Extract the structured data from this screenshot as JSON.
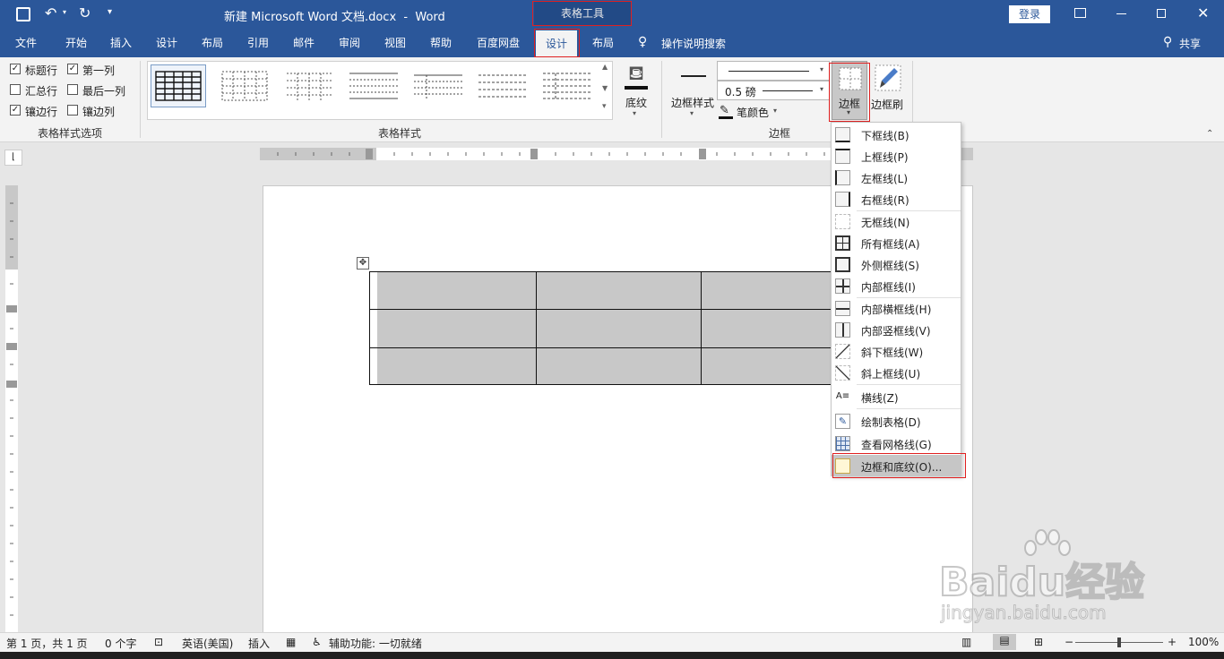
{
  "title_bar": {
    "doc_title": "新建 Microsoft Word 文档.docx  -  Word",
    "context_tool": "表格工具",
    "login_button": "登录"
  },
  "tabs": [
    "文件",
    "开始",
    "插入",
    "设计",
    "布局",
    "引用",
    "邮件",
    "审阅",
    "视图",
    "帮助",
    "百度网盘",
    "设计",
    "布局"
  ],
  "tell_me": "操作说明搜索",
  "share": "共享",
  "ribbon": {
    "style_options": {
      "header_row": "标题行",
      "first_column": "第一列",
      "total_row": "汇总行",
      "last_column": "最后一列",
      "banded_rows": "镶边行",
      "banded_columns": "镶边列",
      "group_label": "表格样式选项"
    },
    "table_styles_label": "表格样式",
    "shading_label": "底纹",
    "border_styles_label": "边框样式",
    "pen_weight": "0.5 磅",
    "pen_color_label": "笔颜色",
    "borders_button": "边框",
    "border_painter": "边框刷",
    "borders_group_label": "边框"
  },
  "borders_menu": [
    "下框线(B)",
    "上框线(P)",
    "左框线(L)",
    "右框线(R)",
    "无框线(N)",
    "所有框线(A)",
    "外侧框线(S)",
    "内部框线(I)",
    "内部横框线(H)",
    "内部竖框线(V)",
    "斜下框线(W)",
    "斜上框线(U)",
    "横线(Z)",
    "绘制表格(D)",
    "查看网格线(G)",
    "边框和底纹(O)..."
  ],
  "status": {
    "page": "第 1 页，共 1 页",
    "words": "0 个字",
    "language": "英语(美国)",
    "insert_mode": "插入",
    "accessibility": "辅助功能: 一切就绪",
    "zoom": "100%"
  },
  "watermark": {
    "brand": "Baidu经验",
    "url": "jingyan.baidu.com"
  },
  "colors": {
    "accent": "#2b579a",
    "highlight": "#e02020",
    "cell_shading": "#c8c8c8"
  }
}
